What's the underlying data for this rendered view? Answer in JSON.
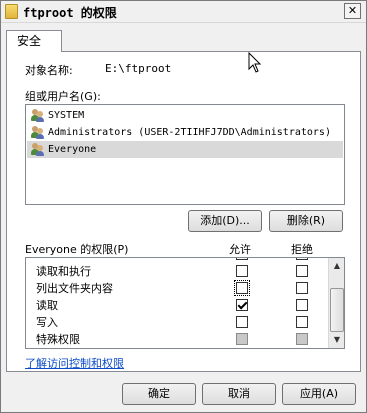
{
  "window": {
    "title": "ftproot 的权限",
    "close_label": "✕"
  },
  "tabs": [
    {
      "label": "安全"
    }
  ],
  "object": {
    "label": "对象名称:",
    "value": "E:\\ftproot"
  },
  "groups": {
    "label": "组或用户名(G):",
    "users": [
      {
        "name": "SYSTEM",
        "selected": false
      },
      {
        "name": "Administrators (USER-2TIIHFJ7DD\\Administrators)",
        "selected": false
      },
      {
        "name": "Everyone",
        "selected": true
      }
    ],
    "add_label": "添加(D)...",
    "remove_label": "删除(R)"
  },
  "permissions": {
    "header": "Everyone 的权限(P)",
    "allow_label": "允许",
    "deny_label": "拒绝",
    "rows": [
      {
        "name": "读取和执行",
        "allow": false,
        "deny": false,
        "special": false
      },
      {
        "name": "列出文件夹内容",
        "allow": false,
        "deny": false,
        "special": false,
        "focused": true
      },
      {
        "name": "读取",
        "allow": true,
        "deny": false,
        "special": false
      },
      {
        "name": "写入",
        "allow": false,
        "deny": false,
        "special": false
      },
      {
        "name": "特殊权限",
        "allow": false,
        "deny": false,
        "special": true
      }
    ]
  },
  "link_text": "了解访问控制和权限",
  "footer": {
    "ok_label": "确定",
    "cancel_label": "取消",
    "apply_label": "应用(A)"
  }
}
